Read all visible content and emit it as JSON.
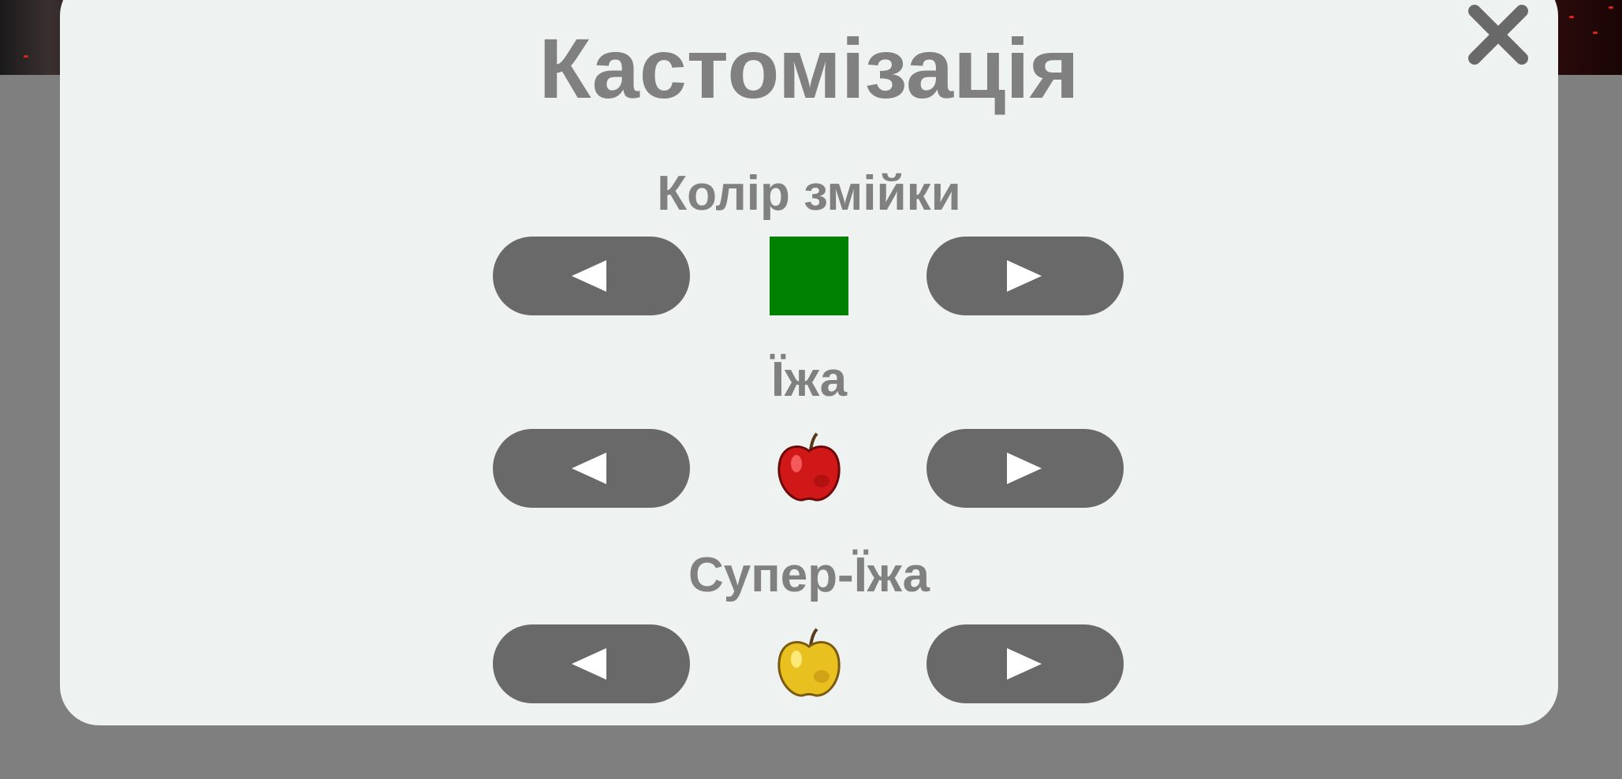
{
  "modal": {
    "title": "Кастомізація",
    "close_icon": "close-x-icon"
  },
  "sections": [
    {
      "label": "Колір змійки",
      "preview_type": "color-swatch",
      "preview_color": "#008000",
      "prev_icon": "triangle-left-icon",
      "next_icon": "triangle-right-icon"
    },
    {
      "label": "Їжа",
      "preview_type": "icon",
      "preview_icon": "red-apple-icon",
      "prev_icon": "triangle-left-icon",
      "next_icon": "triangle-right-icon"
    },
    {
      "label": "Супер-Їжа",
      "preview_type": "icon",
      "preview_icon": "golden-apple-icon",
      "prev_icon": "triangle-left-icon",
      "next_icon": "triangle-right-icon"
    }
  ],
  "colors": {
    "overlay": "#7f7f7f",
    "modal_bg": "#eef2f1",
    "text": "#808080",
    "button": "#696969",
    "arrow": "#ffffff"
  }
}
